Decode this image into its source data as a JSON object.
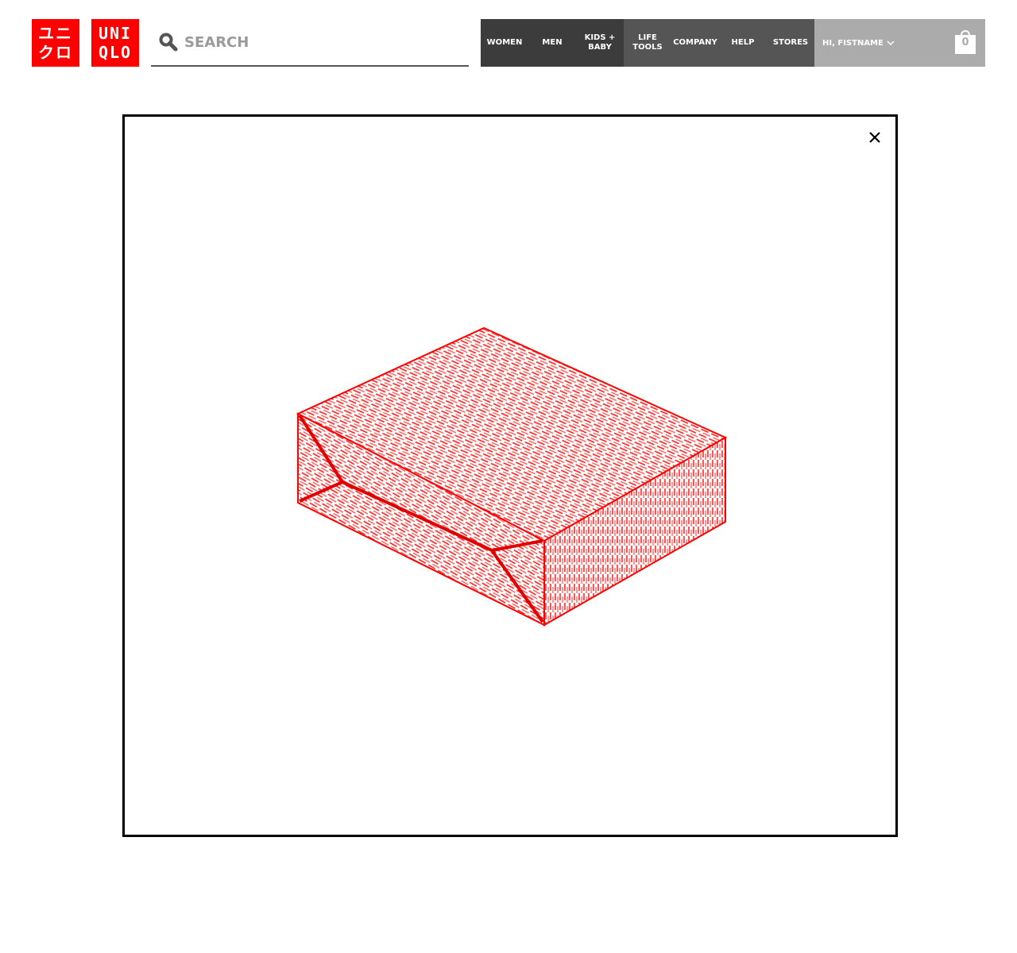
{
  "header": {
    "logo_katakana": "ユニ\nクロ",
    "logo_latin": "UNI\nQLO",
    "search": {
      "placeholder": "SEARCH",
      "value": ""
    },
    "nav": {
      "women": "WOMEN",
      "men": "MEN",
      "kids_baby": "KIDS +\nBABY",
      "life_tools": "LIFE\nTOOLS",
      "company": "COMPANY",
      "help": "HELP",
      "stores": "STORES"
    },
    "account": {
      "greeting": "HI, FISTNAME"
    },
    "cart": {
      "count": "0"
    }
  },
  "colors": {
    "brand_red": "#ff0000",
    "nav_dark": "#3c3c3c",
    "nav_mid": "#555555",
    "account_gray": "#ababab",
    "modal_border": "#000000"
  },
  "icons": {
    "search": "search-icon",
    "chevron": "chevron-down-icon",
    "cart": "shopping-bag-icon",
    "close": "close-icon",
    "illustration": "gift-box-illustration"
  }
}
